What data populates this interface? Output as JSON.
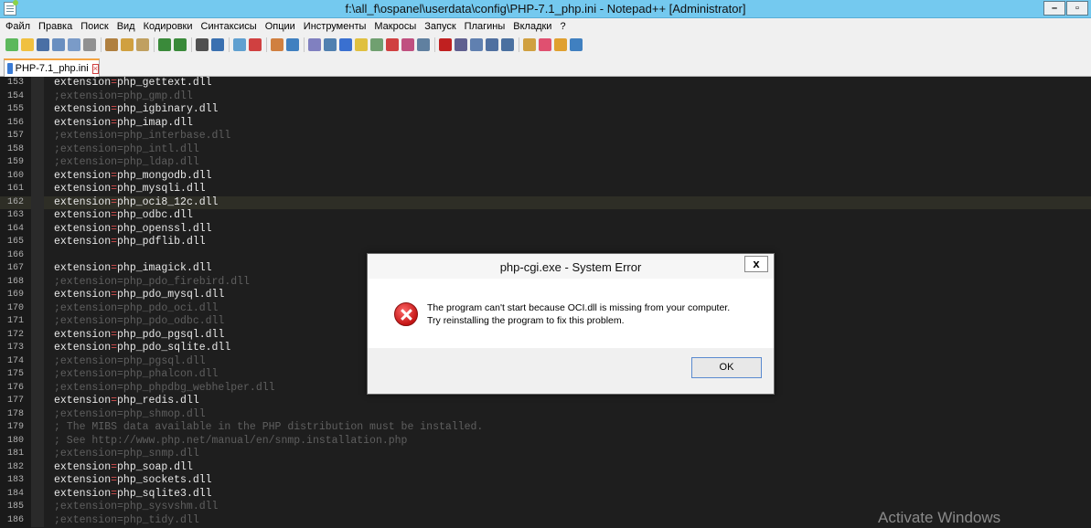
{
  "window": {
    "title": "f:\\all_f\\ospanel\\userdata\\config\\PHP-7.1_php.ini - Notepad++ [Administrator]",
    "minimize_label": "–",
    "restore_label": "▫"
  },
  "menu": [
    "Файл",
    "Правка",
    "Поиск",
    "Вид",
    "Кодировки",
    "Синтаксисы",
    "Опции",
    "Инструменты",
    "Макросы",
    "Запуск",
    "Плагины",
    "Вкладки",
    "?"
  ],
  "toolbar_icon_colors": [
    "#5cb85c",
    "#f0c040",
    "#4a6fa5",
    "#6a8fc0",
    "#7a9bc8",
    "#909090",
    "sep",
    "#b08040",
    "#d0a040",
    "#c0a060",
    "sep",
    "#3a8a3a",
    "#3a8a3a",
    "sep",
    "#505050",
    "#3a70b0",
    "sep",
    "#60a0d0",
    "#d04040",
    "sep",
    "#d08040",
    "#4080c0",
    "sep",
    "#8080c0",
    "#5080b0",
    "#3a70d0",
    "#e0c040",
    "#70a070",
    "#d04040",
    "#c05080",
    "#6080a0",
    "sep",
    "#c02020",
    "#606090",
    "#6080b0",
    "#5070a0",
    "#4a70a0",
    "sep",
    "#d0a040",
    "#e05070",
    "#e0a030",
    "#4080c0"
  ],
  "tab": {
    "label": "PHP-7.1_php.ini",
    "close": "×"
  },
  "editor": {
    "lines": [
      {
        "n": "153",
        "text": "extension=php_gettext.dll",
        "comment": false
      },
      {
        "n": "154",
        "text": ";extension=php_gmp.dll",
        "comment": true
      },
      {
        "n": "155",
        "text": "extension=php_igbinary.dll",
        "comment": false
      },
      {
        "n": "156",
        "text": "extension=php_imap.dll",
        "comment": false
      },
      {
        "n": "157",
        "text": ";extension=php_interbase.dll",
        "comment": true
      },
      {
        "n": "158",
        "text": ";extension=php_intl.dll",
        "comment": true
      },
      {
        "n": "159",
        "text": ";extension=php_ldap.dll",
        "comment": true
      },
      {
        "n": "160",
        "text": "extension=php_mongodb.dll",
        "comment": false
      },
      {
        "n": "161",
        "text": "extension=php_mysqli.dll",
        "comment": false
      },
      {
        "n": "162",
        "text": "extension=php_oci8_12c.dll",
        "comment": false,
        "current": true
      },
      {
        "n": "163",
        "text": "extension=php_odbc.dll",
        "comment": false
      },
      {
        "n": "164",
        "text": "extension=php_openssl.dll",
        "comment": false
      },
      {
        "n": "165",
        "text": "extension=php_pdflib.dll",
        "comment": false
      },
      {
        "n": "166",
        "text": "",
        "comment": false
      },
      {
        "n": "167",
        "text": "extension=php_imagick.dll",
        "comment": false
      },
      {
        "n": "168",
        "text": ";extension=php_pdo_firebird.dll",
        "comment": true
      },
      {
        "n": "169",
        "text": "extension=php_pdo_mysql.dll",
        "comment": false
      },
      {
        "n": "170",
        "text": ";extension=php_pdo_oci.dll",
        "comment": true
      },
      {
        "n": "171",
        "text": ";extension=php_pdo_odbc.dll",
        "comment": true
      },
      {
        "n": "172",
        "text": "extension=php_pdo_pgsql.dll",
        "comment": false
      },
      {
        "n": "173",
        "text": "extension=php_pdo_sqlite.dll",
        "comment": false
      },
      {
        "n": "174",
        "text": ";extension=php_pgsql.dll",
        "comment": true
      },
      {
        "n": "175",
        "text": ";extension=php_phalcon.dll",
        "comment": true
      },
      {
        "n": "176",
        "text": ";extension=php_phpdbg_webhelper.dll",
        "comment": true
      },
      {
        "n": "177",
        "text": "extension=php_redis.dll",
        "comment": false
      },
      {
        "n": "178",
        "text": ";extension=php_shmop.dll",
        "comment": true
      },
      {
        "n": "179",
        "text": "; The MIBS data available in the PHP distribution must be installed.",
        "comment": true
      },
      {
        "n": "180",
        "text": "; See http://www.php.net/manual/en/snmp.installation.php",
        "comment": true
      },
      {
        "n": "181",
        "text": ";extension=php_snmp.dll",
        "comment": true
      },
      {
        "n": "182",
        "text": "extension=php_soap.dll",
        "comment": false
      },
      {
        "n": "183",
        "text": "extension=php_sockets.dll",
        "comment": false
      },
      {
        "n": "184",
        "text": "extension=php_sqlite3.dll",
        "comment": false
      },
      {
        "n": "185",
        "text": ";extension=php_sysvshm.dll",
        "comment": true
      },
      {
        "n": "186",
        "text": ";extension=php_tidy.dll",
        "comment": true
      }
    ]
  },
  "watermark": "Activate Windows",
  "dialog": {
    "title": "php-cgi.exe - System Error",
    "close": "x",
    "message_line1": "The program can't start because OCI.dll is missing from your computer.",
    "message_line2": "Try reinstalling the program to fix this problem.",
    "ok_label": "OK"
  }
}
